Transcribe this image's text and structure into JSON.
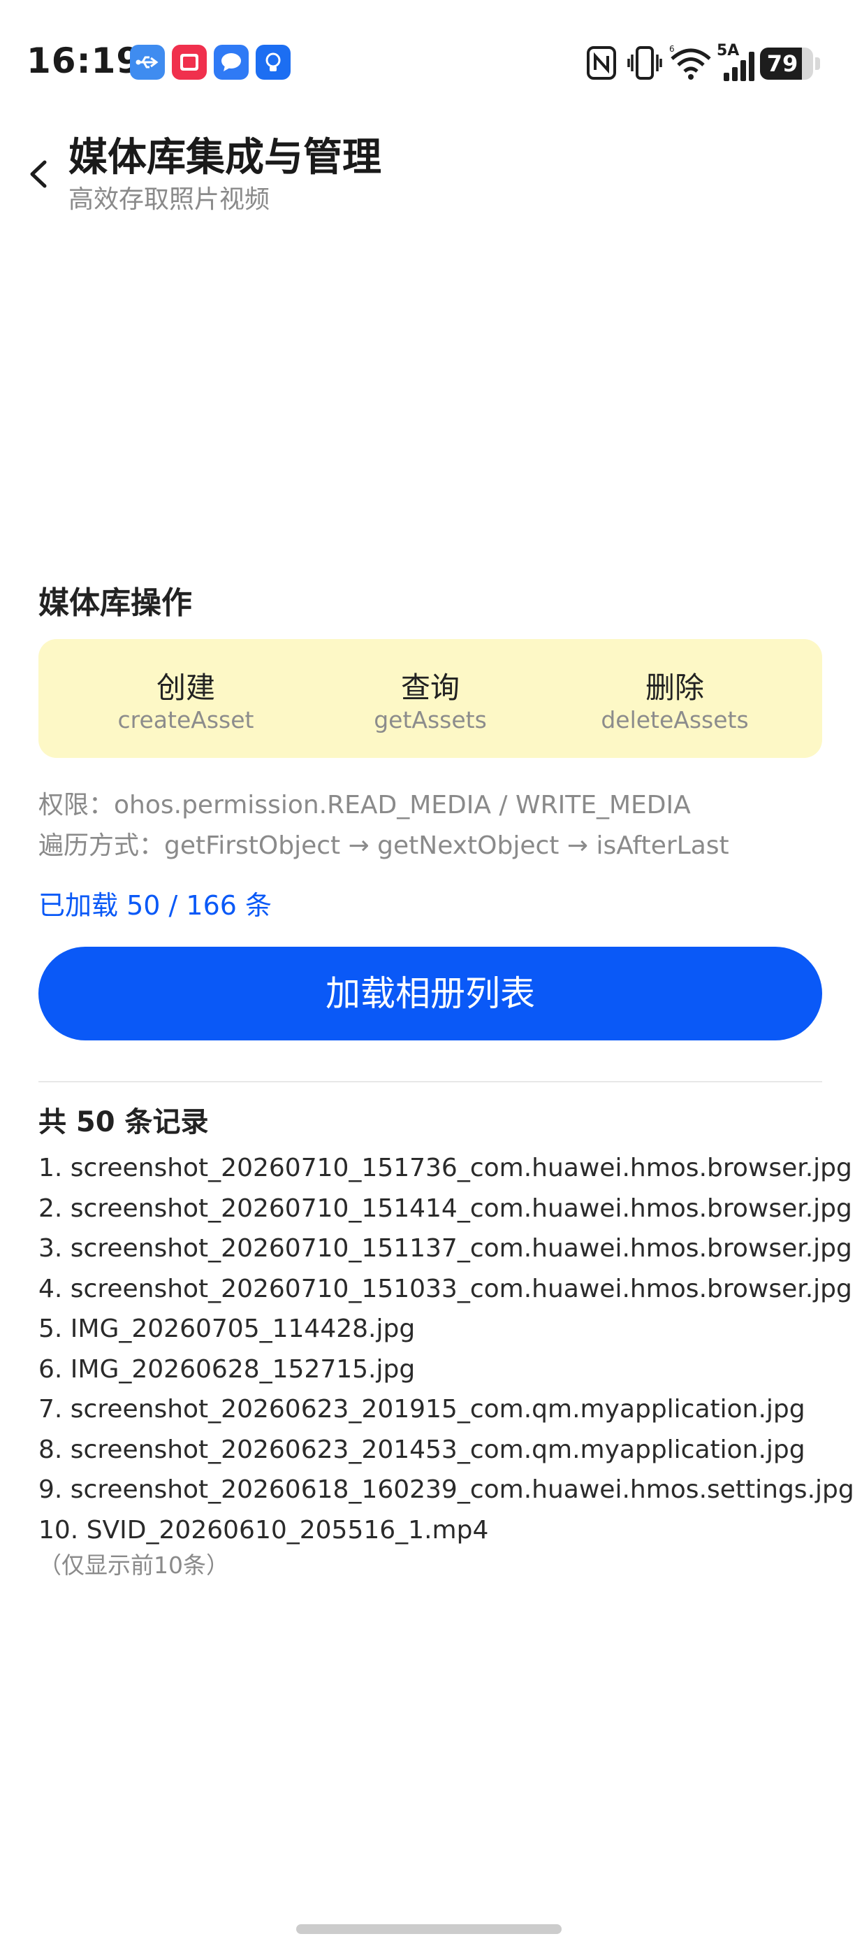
{
  "status_bar": {
    "time": "16:19",
    "app_icons": [
      {
        "name": "usb-icon",
        "color": "#3f8cf0"
      },
      {
        "name": "book-app-icon",
        "color": "#f0304d"
      },
      {
        "name": "message-app-icon",
        "color": "#2f7af5"
      },
      {
        "name": "lightbulb-app-icon",
        "color": "#1c6ef2"
      }
    ],
    "network_label": "5A",
    "battery_level": "79",
    "battery_fraction": 0.79
  },
  "header": {
    "title": "媒体库集成与管理",
    "subtitle": "高效存取照片视频"
  },
  "section": {
    "title": "媒体库操作",
    "operations": [
      {
        "name": "创建",
        "api": "createAsset"
      },
      {
        "name": "查询",
        "api": "getAssets"
      },
      {
        "name": "删除",
        "api": "deleteAssets"
      }
    ]
  },
  "info": {
    "permission": "权限：ohos.permission.READ_MEDIA / WRITE_MEDIA",
    "traversal": "遍历方式：getFirstObject → getNextObject → isAfterLast"
  },
  "loaded_status": "已加载 50 / 166 条",
  "load_button_label": "加载相册列表",
  "records": {
    "header": "共 50 条记录",
    "items": [
      "1. screenshot_20260710_151736_com.huawei.hmos.browser.jpg",
      "2. screenshot_20260710_151414_com.huawei.hmos.browser.jpg",
      "3. screenshot_20260710_151137_com.huawei.hmos.browser.jpg",
      "4. screenshot_20260710_151033_com.huawei.hmos.browser.jpg",
      "5. IMG_20260705_114428.jpg",
      "6. IMG_20260628_152715.jpg",
      "7. screenshot_20260623_201915_com.qm.myapplication.jpg",
      "8. screenshot_20260623_201453_com.qm.myapplication.jpg",
      "9. screenshot_20260618_160239_com.huawei.hmos.settings.jpg",
      "10. SVID_20260610_205516_1.mp4"
    ],
    "note": "（仅显示前10条）"
  },
  "colors": {
    "accent": "#0a59f7",
    "card_background": "#fdf8c6"
  }
}
